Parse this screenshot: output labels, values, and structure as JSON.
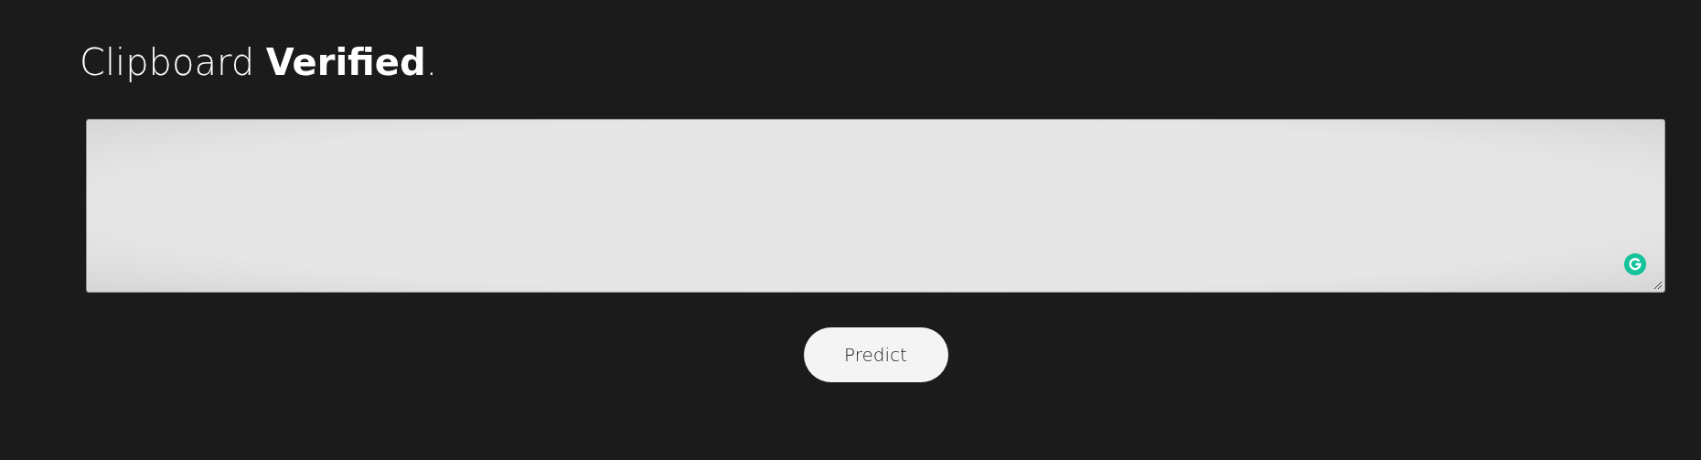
{
  "heading": "Clipboard **Verified**.",
  "button": {
    "label": "Predict"
  }
}
